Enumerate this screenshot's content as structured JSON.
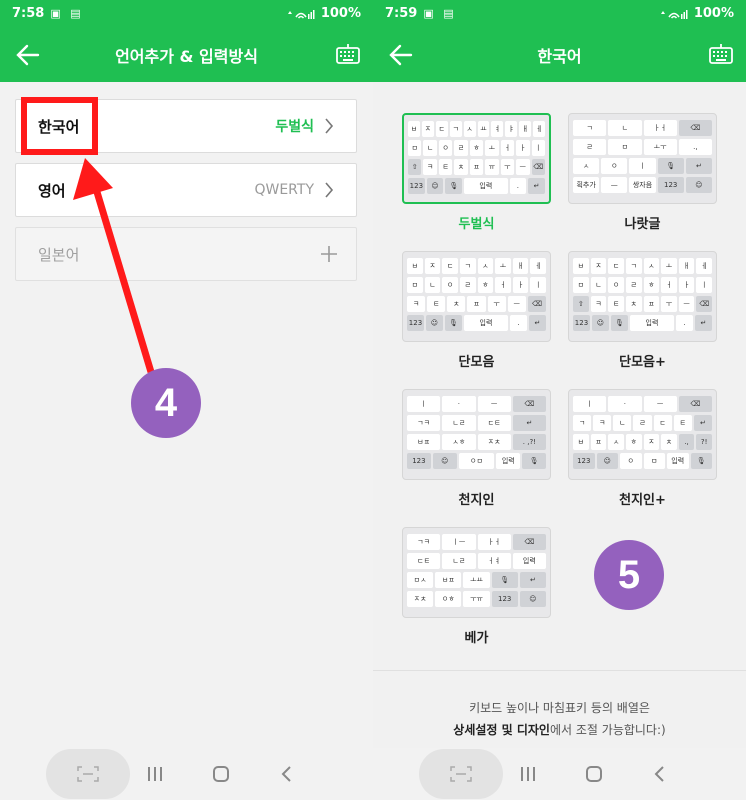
{
  "left": {
    "status": {
      "time": "7:58",
      "battery": "100%"
    },
    "title": "언어추가 & 입력방식",
    "items": [
      {
        "label": "한국어",
        "value": "두벌식"
      },
      {
        "label": "영어",
        "value": "QWERTY"
      },
      {
        "label": "일본어"
      }
    ],
    "step": "4"
  },
  "right": {
    "status": {
      "time": "7:59",
      "battery": "100%"
    },
    "title": "한국어",
    "keyboards": [
      {
        "label": "두벌식",
        "selected": true
      },
      {
        "label": "나랏글"
      },
      {
        "label": "단모음"
      },
      {
        "label": "단모음+"
      },
      {
        "label": "천지인"
      },
      {
        "label": "천지인+"
      },
      {
        "label": "베가"
      }
    ],
    "step": "5",
    "footnote_line1": "키보드 높이나 마침표키 등의 배열은",
    "footnote_bold": "상세설정 및 디자인",
    "footnote_rest": "에서 조절 가능합니다:)"
  },
  "key_texts": {
    "k123": "123",
    "input": "입력",
    "stroke": "획추가",
    "dash": "—",
    "jamo_vowel": "쌍자음",
    "q": "?!",
    "dot": ".",
    "dotdot": ". ,?!"
  },
  "colors": {
    "accent": "#1fbf52",
    "highlight": "#ff1a1a",
    "step": "#9461be"
  }
}
